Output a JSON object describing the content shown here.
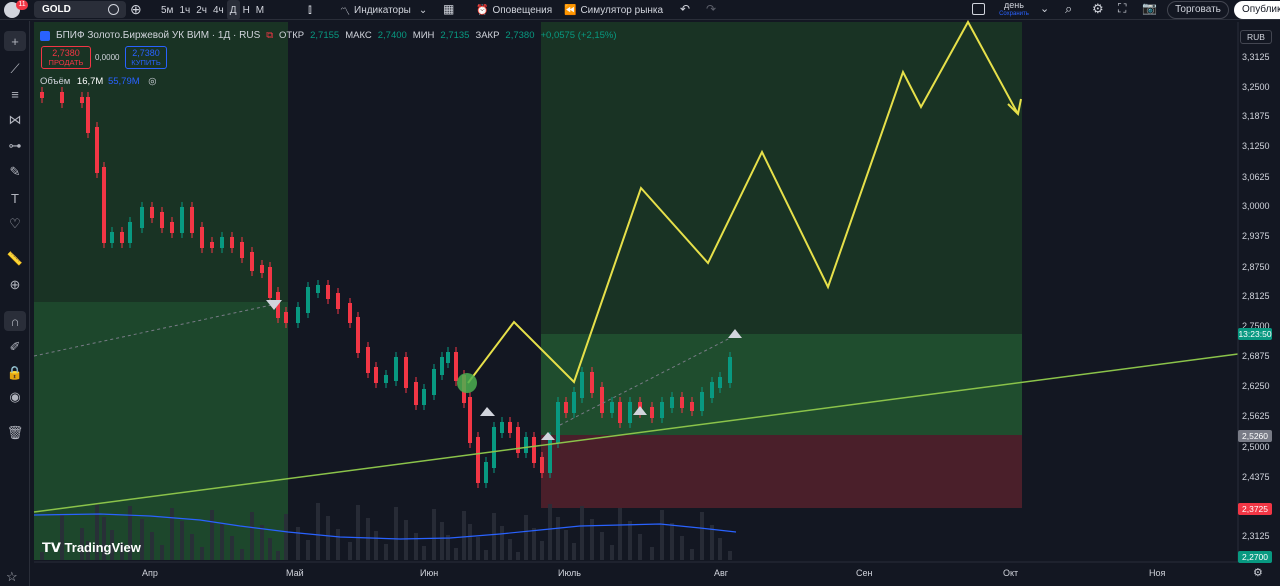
{
  "toolbar": {
    "notification_count": "11",
    "symbol": "GOLD",
    "intervals": [
      "5м",
      "1ч",
      "2ч",
      "4ч",
      "Д",
      "Н",
      "М"
    ],
    "active_interval": "Д",
    "indicators_label": "Индикаторы",
    "alerts_label": "Оповещения",
    "replay_label": "Симулятор рынка",
    "layout_name": "день",
    "layout_status": "Сохранить",
    "trade_label": "Торговать",
    "publish_label": "Опублик"
  },
  "legend": {
    "title": "БПИФ Золото.Биржевой УК ВИМ · 1Д · RUS",
    "open_label": "ОТКР",
    "open": "2,7155",
    "high_label": "МАКС",
    "high": "2,7400",
    "low_label": "МИН",
    "low": "2,7135",
    "close_label": "ЗАКР",
    "close": "2,7380",
    "change": "+0,0575 (+2,15%)",
    "sell_price": "2,7380",
    "sell_label": "ПРОДАТЬ",
    "spread": "0,0000",
    "buy_price": "2,7380",
    "buy_label": "КУПИТЬ",
    "volume_label": "Объём",
    "volume_value": "16,7M",
    "volume_ma": "55,79M"
  },
  "price_axis": {
    "currency": "RUB",
    "labels": [
      "3,3125",
      "3,2500",
      "3,1875",
      "3,1250",
      "3,0625",
      "3,0000",
      "2,9375",
      "2,8750",
      "2,8125",
      "2,7500",
      "2,6875",
      "2,6250",
      "2,5625",
      "2,5000",
      "2,4375",
      "2,3125"
    ],
    "countdown": "13:23:50",
    "badges": [
      {
        "text": "2,5260",
        "color": "#787b86"
      },
      {
        "text": "2,3725",
        "color": "#f23645"
      },
      {
        "text": "2,2700",
        "color": "#089981"
      }
    ]
  },
  "time_axis": [
    "Апр",
    "Май",
    "Июн",
    "Июль",
    "Авг",
    "Сен",
    "Окт",
    "Ноя"
  ],
  "branding": "TradingView",
  "colors": {
    "up": "#089981",
    "down": "#f23645",
    "projection": "#e6e04a",
    "trend": "#8bc34a",
    "zone_green": "#1f4d2e",
    "zone_red": "#4a1f2a"
  }
}
